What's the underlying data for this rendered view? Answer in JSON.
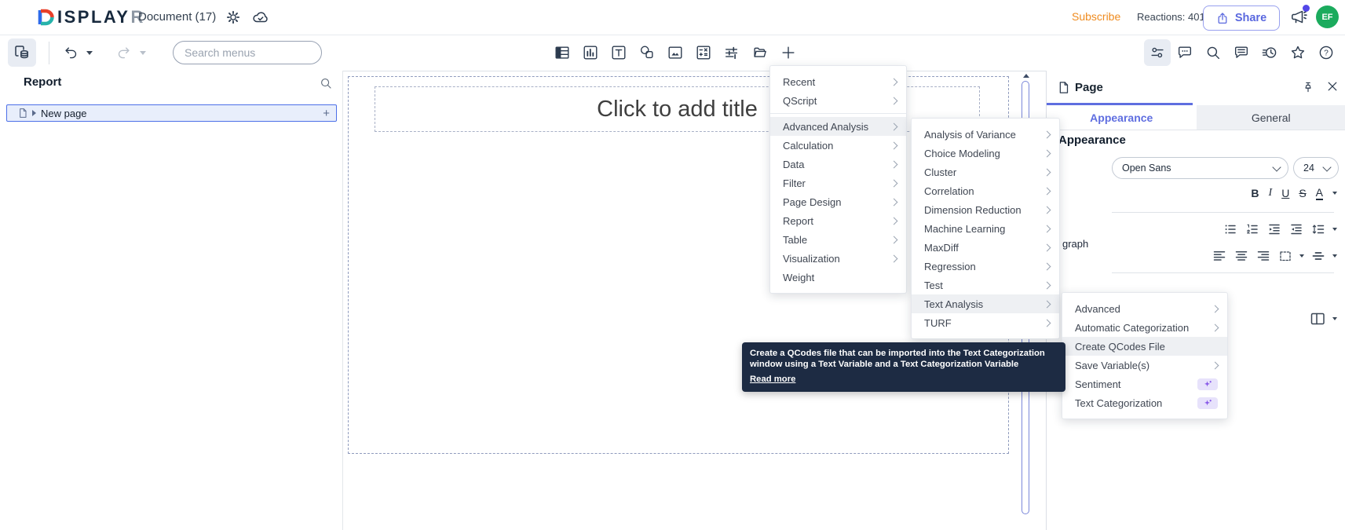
{
  "topbar": {
    "logo_main": "ISPLAY",
    "logo_r": "R",
    "document_label": "Document (17)",
    "subscribe_label": "Subscribe",
    "reactions_label": "Reactions: 401",
    "share_label": "Share",
    "avatar_initials": "EF"
  },
  "toolbar": {
    "search_placeholder": "Search menus"
  },
  "sidebar": {
    "title": "Report",
    "page_item_label": "New page",
    "add_label": "+"
  },
  "canvas": {
    "title_placeholder": "Click to add title"
  },
  "panel": {
    "title": "Page",
    "tabs": {
      "appearance": "Appearance",
      "general": "General"
    },
    "section_title": "Appearance",
    "font_name": "Open Sans",
    "font_size": "24",
    "paragraph_fragment": "graph",
    "format": {
      "bold": "B",
      "italic": "I",
      "underline": "U",
      "strike": "S",
      "color": "A"
    },
    "help_glyph": "?"
  },
  "menus": {
    "main": {
      "items": [
        {
          "label": "Recent"
        },
        {
          "label": "QScript"
        },
        {
          "label": "Advanced Analysis"
        },
        {
          "label": "Calculation"
        },
        {
          "label": "Data"
        },
        {
          "label": "Filter"
        },
        {
          "label": "Page Design"
        },
        {
          "label": "Report"
        },
        {
          "label": "Table"
        },
        {
          "label": "Visualization"
        },
        {
          "label": "Weight"
        }
      ]
    },
    "advanced_analysis": {
      "items": [
        {
          "label": "Analysis of Variance"
        },
        {
          "label": "Choice Modeling"
        },
        {
          "label": "Cluster"
        },
        {
          "label": "Correlation"
        },
        {
          "label": "Dimension Reduction"
        },
        {
          "label": "Machine Learning"
        },
        {
          "label": "MaxDiff"
        },
        {
          "label": "Regression"
        },
        {
          "label": "Test"
        },
        {
          "label": "Text Analysis"
        },
        {
          "label": "TURF"
        }
      ]
    },
    "text_analysis": {
      "items": [
        {
          "label": "Advanced"
        },
        {
          "label": "Automatic Categorization"
        },
        {
          "label": "Create QCodes File"
        },
        {
          "label": "Save Variable(s)"
        },
        {
          "label": "Sentiment"
        },
        {
          "label": "Text Categorization"
        }
      ]
    }
  },
  "tooltip": {
    "text": "Create a QCodes file that can be imported into the Text Categorization window using a Text Variable and a Text Categorization Variable",
    "link_label": "Read more"
  },
  "colors": {
    "accent_purple": "#5f6ee0",
    "subscribe_orange": "#ef8b1f",
    "avatar_green": "#1bab5d",
    "tooltip_bg": "#1d2b43",
    "badge_purple": "#8656e8",
    "highlight_row": "#eef0f3"
  },
  "icons": {
    "topbar": [
      "displayr-logo",
      "gear-icon",
      "cloud-sync-icon",
      "share-upload-icon",
      "megaphone-icon"
    ],
    "toolbar_left": [
      "pages-icon",
      "undo-icon",
      "redo-icon"
    ],
    "toolbar_center": [
      "table-icon",
      "chart-icon",
      "text-icon",
      "shapes-icon",
      "image-icon",
      "calculator-icon",
      "sliders-icon",
      "folder-icon",
      "plus-icon"
    ],
    "toolbar_right": [
      "toggles-icon",
      "comment-icon",
      "search-icon",
      "notes-icon",
      "history-icon",
      "star-icon",
      "help-icon"
    ],
    "panel": [
      "page-icon",
      "pin-icon",
      "close-icon",
      "bullet-list-icon",
      "numbered-list-icon",
      "outdent-icon",
      "indent-icon",
      "line-spacing-icon",
      "align-left-icon",
      "align-center-icon",
      "align-right-icon",
      "selection-box-icon",
      "vertical-center-icon",
      "columns-icon"
    ],
    "menu": [
      "submenu-chevron-icon",
      "ai-sparkle-icon"
    ]
  }
}
